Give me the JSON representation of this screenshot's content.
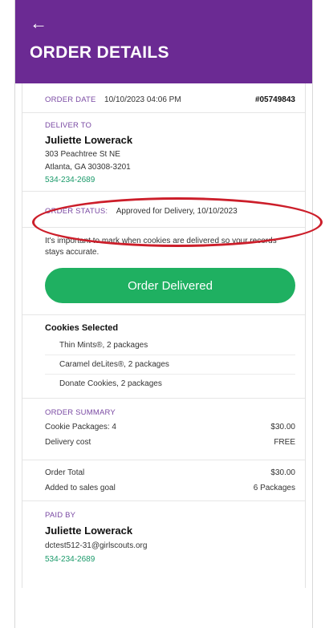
{
  "header": {
    "back_icon": "←",
    "title": "ORDER DETAILS"
  },
  "order": {
    "date_label": "ORDER DATE",
    "date_value": "10/10/2023 04:06 PM",
    "number": "#05749843"
  },
  "deliver_to": {
    "label": "DELIVER TO",
    "name": "Juliette Lowerack",
    "address1": "303 Peachtree St NE",
    "address2": "Atlanta, GA 30308-3201",
    "phone": "534-234-2689"
  },
  "status": {
    "label": "ORDER STATUS:",
    "value": "Approved for Delivery, 10/10/2023",
    "annotation_color": "#cc1e2a"
  },
  "notice": {
    "text": "It's important to mark when cookies are delivered so your records stays accurate."
  },
  "action": {
    "button_label": "Order Delivered",
    "button_color": "#1fb061"
  },
  "cookies": {
    "heading": "Cookies Selected",
    "items": [
      "Thin Mints®, 2 packages",
      "Caramel deLites®, 2 packages",
      "Donate Cookies, 2 packages"
    ]
  },
  "summary": {
    "label": "ORDER SUMMARY",
    "rows": [
      {
        "label": "Cookie Packages: 4",
        "value": "$30.00"
      },
      {
        "label": "Delivery cost",
        "value": "FREE"
      }
    ],
    "total_rows": [
      {
        "label": "Order Total",
        "value": "$30.00"
      },
      {
        "label": "Added to sales goal",
        "value": "6 Packages"
      }
    ]
  },
  "paid_by": {
    "label": "PAID BY",
    "name": "Juliette Lowerack",
    "email": "dctest512-31@girlscouts.org",
    "phone": "534-234-2689"
  },
  "colors": {
    "header_bg": "#6b2a93",
    "accent_label": "#7a4aa3",
    "link": "#1a9a6a"
  }
}
